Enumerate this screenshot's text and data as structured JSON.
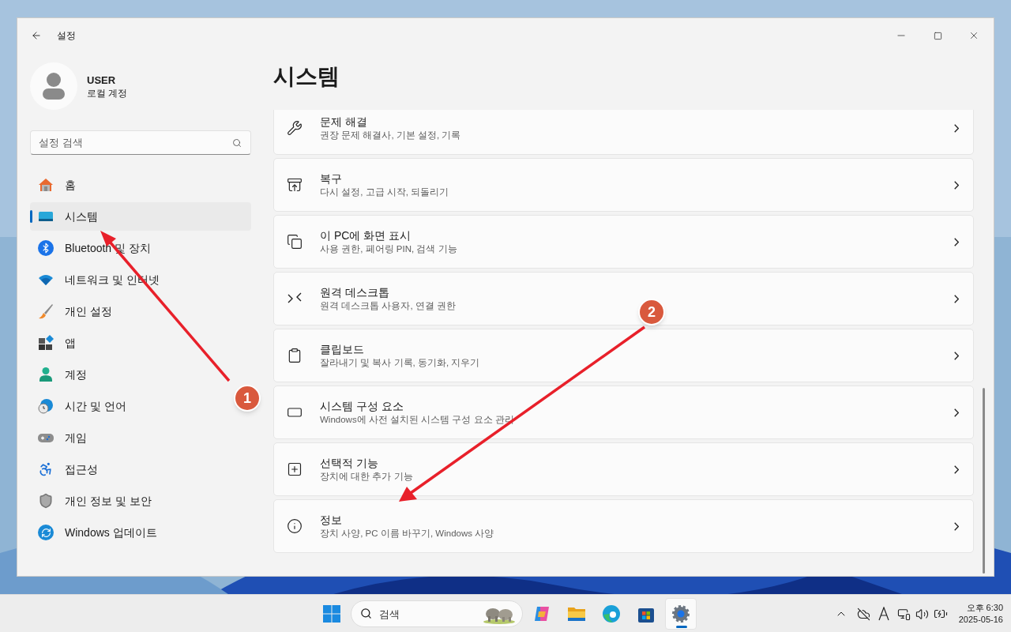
{
  "window": {
    "title": "설정"
  },
  "account": {
    "name": "USER",
    "type": "로컬 계정"
  },
  "search": {
    "placeholder": "설정 검색"
  },
  "nav": [
    {
      "label": "홈",
      "selected": false
    },
    {
      "label": "시스템",
      "selected": true
    },
    {
      "label": "Bluetooth 및 장치",
      "selected": false
    },
    {
      "label": "네트워크 및 인터넷",
      "selected": false
    },
    {
      "label": "개인 설정",
      "selected": false
    },
    {
      "label": "앱",
      "selected": false
    },
    {
      "label": "계정",
      "selected": false
    },
    {
      "label": "시간 및 언어",
      "selected": false
    },
    {
      "label": "게임",
      "selected": false
    },
    {
      "label": "접근성",
      "selected": false
    },
    {
      "label": "개인 정보 및 보안",
      "selected": false
    },
    {
      "label": "Windows 업데이트",
      "selected": false
    }
  ],
  "page_title": "시스템",
  "items": [
    {
      "title": "문제 해결",
      "subtitle": "권장 문제 해결사, 기본 설정, 기록"
    },
    {
      "title": "복구",
      "subtitle": "다시 설정, 고급 시작, 되돌리기"
    },
    {
      "title": "이 PC에 화면 표시",
      "subtitle": "사용 권한, 페어링 PIN, 검색 기능"
    },
    {
      "title": "원격 데스크톱",
      "subtitle": "원격 데스크톱 사용자, 연결 권한"
    },
    {
      "title": "클립보드",
      "subtitle": "잘라내기 및 복사 기록, 동기화, 지우기"
    },
    {
      "title": "시스템 구성 요소",
      "subtitle": "Windows에 사전 설치된 시스템 구성 요소 관리"
    },
    {
      "title": "선택적 기능",
      "subtitle": "장치에 대한 추가 기능"
    },
    {
      "title": "정보",
      "subtitle": "장치 사양, PC 이름 바꾸기, Windows 사양"
    }
  ],
  "annotations": [
    {
      "label": "1"
    },
    {
      "label": "2"
    }
  ],
  "taskbar": {
    "search_placeholder": "검색",
    "pinned_apps": [
      {
        "selected": false
      },
      {
        "selected": false
      },
      {
        "selected": false
      },
      {
        "selected": false
      },
      {
        "selected": true
      }
    ],
    "time": "오후 6:30",
    "date": "2025-05-16"
  }
}
